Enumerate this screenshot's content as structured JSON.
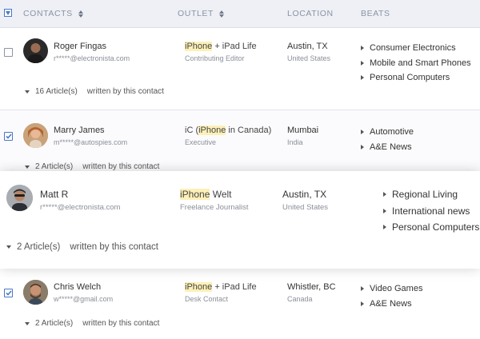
{
  "header": {
    "contacts_label": "CONTACTS",
    "outlet_label": "OUTLET",
    "location_label": "LOCATION",
    "beats_label": "BEATS"
  },
  "contacts": [
    {
      "name": "Roger Fingas",
      "email": "r*****@electronista.com",
      "outlet_highlight": "iPhone",
      "outlet_rest": " + iPad Life",
      "role": "Contributing Editor",
      "city": "Austin, TX",
      "country": "United States",
      "beats": [
        "Consumer Electronics",
        "Mobile and Smart Phones",
        "Personal Computers"
      ],
      "articles": "16 Article(s)",
      "articles_suffix": "written by this contact",
      "checked": false
    },
    {
      "name": "Marry James",
      "email": "m*****@autospies.com",
      "outlet_prefix": "iC (",
      "outlet_highlight": "iPhone",
      "outlet_rest": " in Canada)",
      "role": "Executive",
      "city": "Mumbai",
      "country": "India",
      "beats": [
        "Automotive",
        "A&E News"
      ],
      "articles": "2 Article(s)",
      "articles_suffix": "written by this contact",
      "checked": true
    },
    {
      "name": "Matt R",
      "email": "r*****@electronista.com",
      "outlet_highlight": "iPhone",
      "outlet_rest": " Welt",
      "role": "Freelance Journalist",
      "city": "Austin, TX",
      "country": "United States",
      "beats": [
        "Regional Living",
        "International news",
        "Personal Computers"
      ],
      "articles": "2 Article(s)",
      "articles_suffix": "written by this contact",
      "checked": false
    },
    {
      "name": "Chris Welch",
      "email": "w*****@gmail.com",
      "outlet_highlight": "iPhone",
      "outlet_rest": " + iPad Life",
      "role": "Desk Contact",
      "city": "Whistler, BC",
      "country": "Canada",
      "beats": [
        "Video Games",
        "A&E News"
      ],
      "articles": "2 Article(s)",
      "articles_suffix": "written by this contact",
      "checked": true
    }
  ],
  "colors": {
    "header_bg": "#eef0f5",
    "highlight": "#fdf0b8",
    "checkbox_accent": "#4a77c4"
  }
}
